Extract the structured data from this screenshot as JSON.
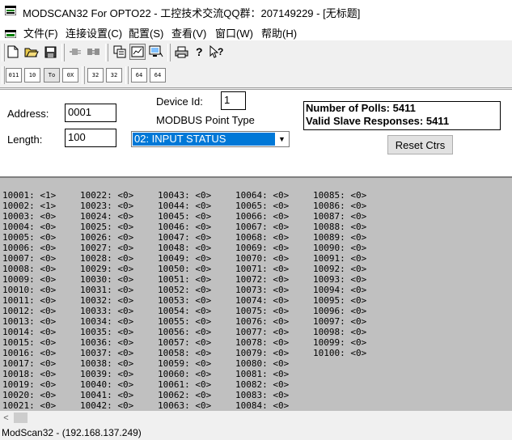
{
  "window": {
    "title": "MODSCAN32 For OPTO22 - 工控技术交流QQ群：207149229 - [无标题]"
  },
  "menu": [
    "文件(F)",
    "连接设置(C)",
    "配置(S)",
    "查看(V)",
    "窗口(W)",
    "帮助(H)"
  ],
  "toolbar": {
    "row1_icons": [
      "new-file-icon",
      "open-folder-icon",
      "save-icon",
      "connect-icon",
      "disconnect-icon",
      "display-setup-icon",
      "chart-view-icon",
      "monitor-view-icon",
      "print-icon",
      "about-icon",
      "context-help-icon"
    ],
    "row2_buttons": [
      "011",
      "10",
      "To",
      "0X",
      "32",
      "32",
      "64",
      "64"
    ]
  },
  "form": {
    "address_label": "Address:",
    "address_value": "0001",
    "length_label": "Length:",
    "length_value": "100",
    "device_id_label": "Device Id:",
    "device_id_value": "1",
    "point_type_label": "MODBUS Point Type",
    "point_type_value": "02: INPUT STATUS",
    "polls_text": "Number of Polls: 5411",
    "responses_text": "Valid Slave Responses: 5411",
    "reset_label": "Reset Ctrs"
  },
  "columns": [
    [
      "10001: <1>",
      "10002: <1>",
      "10003: <0>",
      "10004: <0>",
      "10005: <0>",
      "10006: <0>",
      "10007: <0>",
      "10008: <0>",
      "10009: <0>",
      "10010: <0>",
      "10011: <0>",
      "10012: <0>",
      "10013: <0>",
      "10014: <0>",
      "10015: <0>",
      "10016: <0>",
      "10017: <0>",
      "10018: <0>",
      "10019: <0>",
      "10020: <0>",
      "10021: <0>"
    ],
    [
      "10022: <0>",
      "10023: <0>",
      "10024: <0>",
      "10025: <0>",
      "10026: <0>",
      "10027: <0>",
      "10028: <0>",
      "10029: <0>",
      "10030: <0>",
      "10031: <0>",
      "10032: <0>",
      "10033: <0>",
      "10034: <0>",
      "10035: <0>",
      "10036: <0>",
      "10037: <0>",
      "10038: <0>",
      "10039: <0>",
      "10040: <0>",
      "10041: <0>",
      "10042: <0>"
    ],
    [
      "10043: <0>",
      "10044: <0>",
      "10045: <0>",
      "10046: <0>",
      "10047: <0>",
      "10048: <0>",
      "10049: <0>",
      "10050: <0>",
      "10051: <0>",
      "10052: <0>",
      "10053: <0>",
      "10054: <0>",
      "10055: <0>",
      "10056: <0>",
      "10057: <0>",
      "10058: <0>",
      "10059: <0>",
      "10060: <0>",
      "10061: <0>",
      "10062: <0>",
      "10063: <0>"
    ],
    [
      "10064: <0>",
      "10065: <0>",
      "10066: <0>",
      "10067: <0>",
      "10068: <0>",
      "10069: <0>",
      "10070: <0>",
      "10071: <0>",
      "10072: <0>",
      "10073: <0>",
      "10074: <0>",
      "10075: <0>",
      "10076: <0>",
      "10077: <0>",
      "10078: <0>",
      "10079: <0>",
      "10080: <0>",
      "10081: <0>",
      "10082: <0>",
      "10083: <0>",
      "10084: <0>"
    ],
    [
      "10085: <0>",
      "10086: <0>",
      "10087: <0>",
      "10088: <0>",
      "10089: <0>",
      "10090: <0>",
      "10091: <0>",
      "10092: <0>",
      "10093: <0>",
      "10094: <0>",
      "10095: <0>",
      "10096: <0>",
      "10097: <0>",
      "10098: <0>",
      "10099: <0>",
      "10100: <0>"
    ]
  ],
  "status": {
    "text": "ModScan32 - (192.168.137.249)"
  },
  "colors": {
    "data_bg": "#c0c0c0",
    "selection": "#0078d7",
    "panel_bg": "#ffffff"
  }
}
